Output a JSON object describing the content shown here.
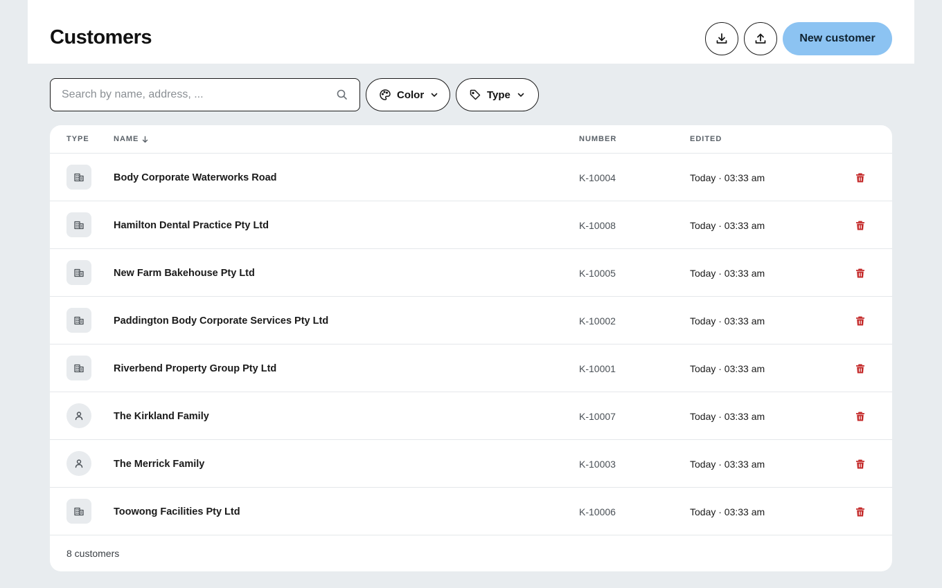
{
  "header": {
    "title": "Customers",
    "download_icon": "download-icon",
    "upload_icon": "upload-icon",
    "new_button": "New customer",
    "accent_color": "#8cc3f2"
  },
  "toolbar": {
    "search_placeholder": "Search by name, address, ...",
    "search_value": "",
    "filter_color": "Color",
    "filter_type": "Type"
  },
  "table": {
    "columns": {
      "type": "TYPE",
      "name": "NAME",
      "number": "NUMBER",
      "edited": "EDITED"
    },
    "sort": {
      "column": "name",
      "direction": "descending-arrow"
    },
    "rows": [
      {
        "type": "company",
        "name": "Body Corporate Waterworks Road",
        "number": "K-10004",
        "edited": "Today · 03:33 am"
      },
      {
        "type": "company",
        "name": "Hamilton Dental Practice Pty Ltd",
        "number": "K-10008",
        "edited": "Today · 03:33 am"
      },
      {
        "type": "company",
        "name": "New Farm Bakehouse Pty Ltd",
        "number": "K-10005",
        "edited": "Today · 03:33 am"
      },
      {
        "type": "company",
        "name": "Paddington Body Corporate Services Pty Ltd",
        "number": "K-10002",
        "edited": "Today · 03:33 am"
      },
      {
        "type": "company",
        "name": "Riverbend Property Group Pty Ltd",
        "number": "K-10001",
        "edited": "Today · 03:33 am"
      },
      {
        "type": "person",
        "name": "The Kirkland Family",
        "number": "K-10007",
        "edited": "Today · 03:33 am"
      },
      {
        "type": "person",
        "name": "The Merrick Family",
        "number": "K-10003",
        "edited": "Today · 03:33 am"
      },
      {
        "type": "company",
        "name": "Toowong Facilities Pty Ltd",
        "number": "K-10006",
        "edited": "Today · 03:33 am"
      }
    ],
    "delete_color": "#c42a2a"
  },
  "footer": {
    "count_text": "8 customers"
  }
}
